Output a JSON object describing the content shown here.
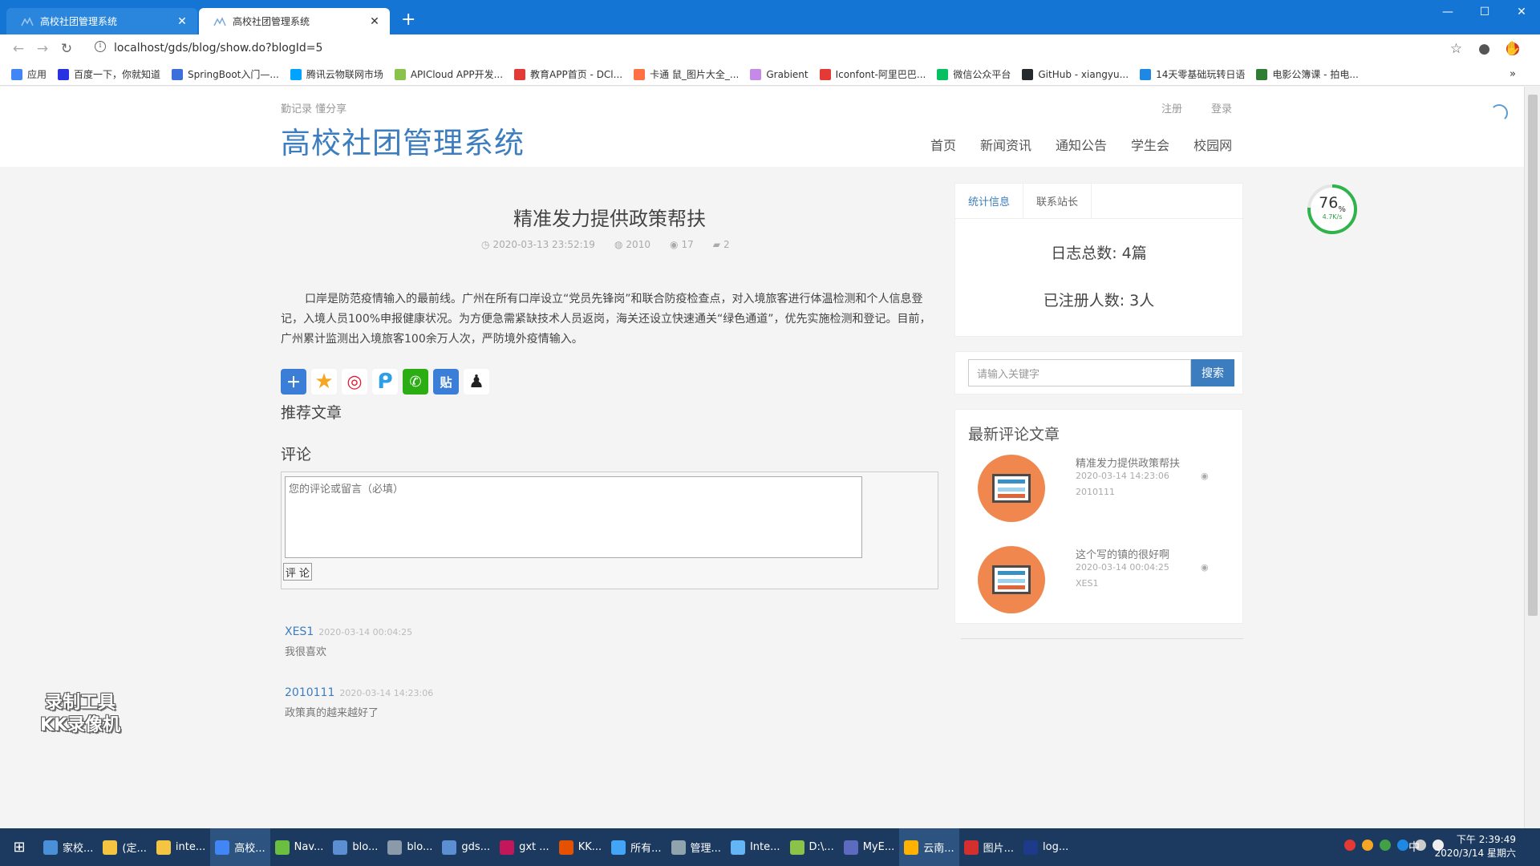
{
  "browser": {
    "tabs": [
      {
        "title": "高校社团管理系统",
        "active": false
      },
      {
        "title": "高校社团管理系统",
        "active": true
      }
    ],
    "url": "localhost/gds/blog/show.do?blogId=5",
    "bookmarks": [
      {
        "label": "应用",
        "color": "#4285f4"
      },
      {
        "label": "百度一下，你就知道",
        "color": "#2932e1"
      },
      {
        "label": "SpringBoot入门—...",
        "color": "#3b6fd9"
      },
      {
        "label": "腾讯云物联网市场",
        "color": "#00a3ff"
      },
      {
        "label": "APICloud APP开发...",
        "color": "#8bc34a"
      },
      {
        "label": "教育APP首页 - DCl...",
        "color": "#e53935"
      },
      {
        "label": "卡通 鼠_图片大全_...",
        "color": "#ff7043"
      },
      {
        "label": "Grabient",
        "color": "#c589e8"
      },
      {
        "label": "Iconfont-阿里巴巴...",
        "color": "#e53935"
      },
      {
        "label": "微信公众平台",
        "color": "#07c160"
      },
      {
        "label": "GitHub - xiangyu...",
        "color": "#24292e"
      },
      {
        "label": "14天零基础玩转日语",
        "color": "#1e88e5"
      },
      {
        "label": "电影公簿课 - 拍电...",
        "color": "#2e7d32"
      }
    ]
  },
  "site": {
    "subtitle": "勤记录 懂分享",
    "title": "高校社团管理系统",
    "auth": {
      "register": "注册",
      "login": "登录"
    },
    "nav": [
      "首页",
      "新闻资讯",
      "通知公告",
      "学生会",
      "校园网"
    ]
  },
  "article": {
    "title": "精准发力提供政策帮扶",
    "date": "2020-03-13 23:52:19",
    "author": "2010",
    "views": "17",
    "comments": "2",
    "content": "口岸是防范疫情输入的最前线。广州在所有口岸设立“党员先锋岗”和联合防疫检查点，对入境旅客进行体温检测和个人信息登记，入境人员100%申报健康状况。为方便急需紧缺技术人员返岗，海关还设立快速通关“绿色通道”，优先实施检测和登记。目前，广州累计监测出入境旅客100余万人次，严防境外疫情输入。",
    "recommend_label": "推荐文章",
    "comment_label": "评论",
    "comment_placeholder": "您的评论或留言（必填）",
    "comment_button": "评 论",
    "comment_list": [
      {
        "user": "XES1",
        "time": "2020-03-14 00:04:25",
        "text": "我很喜欢"
      },
      {
        "user": "2010111",
        "time": "2020-03-14 14:23:06",
        "text": "政策真的越来越好了"
      }
    ]
  },
  "sidebar": {
    "tabs": [
      "统计信息",
      "联系站长"
    ],
    "stats": {
      "posts": "日志总数: 4篇",
      "users": "已注册人数: 3人"
    },
    "search": {
      "placeholder": "请输入关键字",
      "button": "搜索"
    },
    "latest_title": "最新评论文章",
    "latest": [
      {
        "title": "精准发力提供政策帮扶",
        "date": "2020-03-14 14:23:06",
        "author": "2010111"
      },
      {
        "title": "这个写的镇的很好啊",
        "date": "2020-03-14 00:04:25",
        "author": "XES1"
      }
    ]
  },
  "widget": {
    "percent": "76",
    "unit": "%",
    "speed": "4.7K/s"
  },
  "watermark": {
    "line1": "录制工具",
    "line2": "KK录像机"
  },
  "taskbar": {
    "items": [
      {
        "label": "家校...",
        "color": "#4a90d9"
      },
      {
        "label": "(定...",
        "color": "#f5c542"
      },
      {
        "label": "inte...",
        "color": "#f5c542"
      },
      {
        "label": "高校...",
        "color": "#4285f4",
        "active": true
      },
      {
        "label": "Nav...",
        "color": "#6abf40"
      },
      {
        "label": "blo...",
        "color": "#5b8fd1"
      },
      {
        "label": "blo...",
        "color": "#8a9aa8"
      },
      {
        "label": "gds...",
        "color": "#5b8fd1"
      },
      {
        "label": "gxt ...",
        "color": "#c2185b"
      },
      {
        "label": "KK...",
        "color": "#e65100"
      },
      {
        "label": "所有...",
        "color": "#42a5f5"
      },
      {
        "label": "管理...",
        "color": "#90a4ae"
      },
      {
        "label": "Inte...",
        "color": "#64b5f6"
      },
      {
        "label": "D:\\...",
        "color": "#8bc34a"
      },
      {
        "label": "MyE...",
        "color": "#5c6bc0"
      },
      {
        "label": "云南...",
        "color": "#ffb300",
        "active": true
      },
      {
        "label": "图片...",
        "color": "#d32f2f"
      },
      {
        "label": "log...",
        "color": "#1e3a8a"
      }
    ],
    "ime": "中",
    "time": "下午 2:39:49",
    "date": "2020/3/14 星期六"
  }
}
